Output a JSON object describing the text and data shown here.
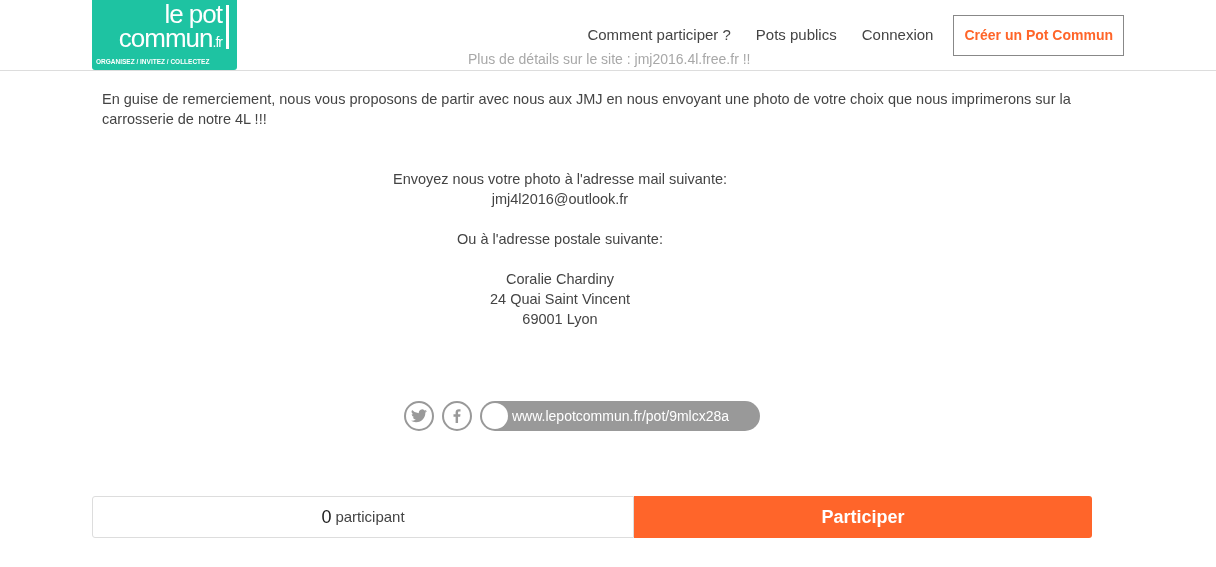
{
  "background_text": [
    "Plus de détails sur le site : jmj2016.4l.free.fr !!"
  ],
  "header": {
    "logo": {
      "line_1": "le pot",
      "line_2": "commun",
      "suffix": ".fr",
      "tagline": "ORGANISEZ / INVITEZ / COLLECTEZ"
    },
    "nav": [
      "Comment participer ?",
      "Pots publics",
      "Connexion"
    ],
    "cta": "Créer un Pot Commun"
  },
  "intro": "En guise de remerciement, nous vous proposons de partir avec nous aux JMJ en nous envoyant une photo de votre choix que nous imprimerons sur la carrosserie de notre 4L !!!",
  "address_block": [
    [
      "Envoyez nous votre photo à l'adresse mail suivante:",
      "jmj4l2016@outlook.fr"
    ],
    [
      "Ou à l'adresse postale suivante:"
    ],
    [
      "Coralie Chardiny",
      "24 Quai Saint Vincent",
      "69001 Lyon"
    ]
  ],
  "share": {
    "url": "www.lepotcommun.fr/pot/9mlcx28a",
    "url_toggle_on": false
  },
  "footer": {
    "count": "0",
    "count_label": "participant",
    "button": "Participer"
  }
}
